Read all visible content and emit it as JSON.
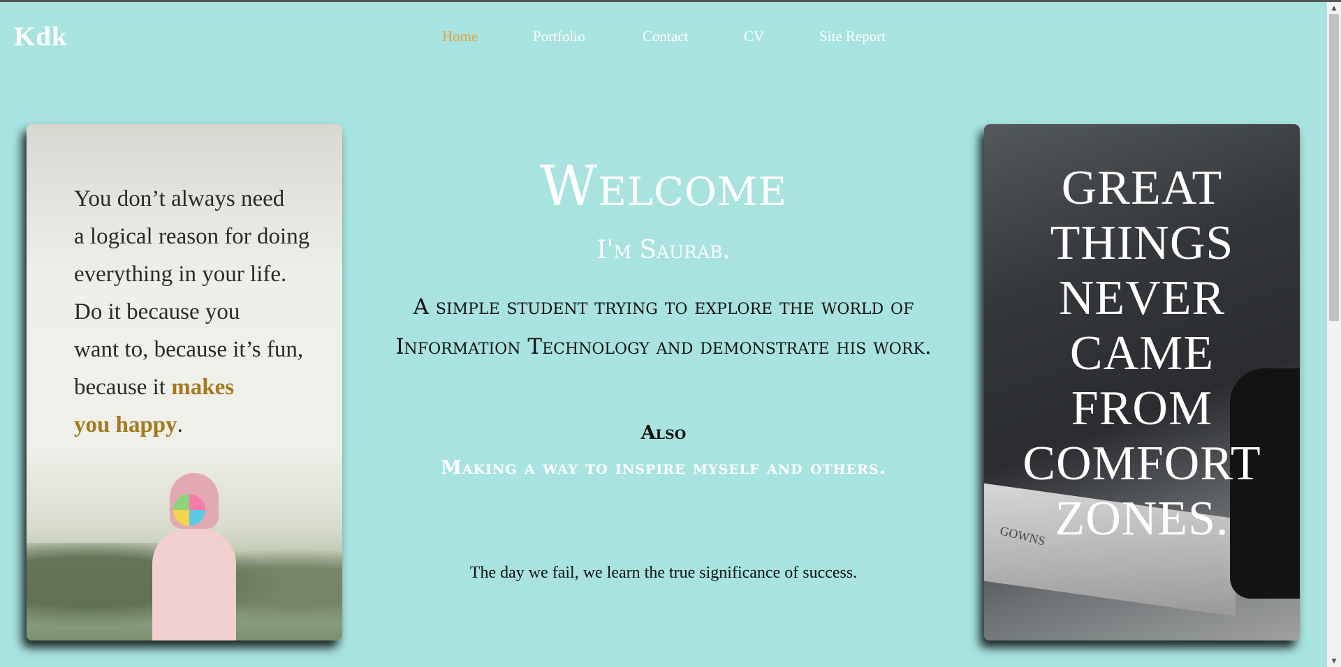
{
  "header": {
    "logo": "Kdk",
    "nav": [
      {
        "label": "Home",
        "active": true
      },
      {
        "label": "Portfolio",
        "active": false
      },
      {
        "label": "Contact",
        "active": false
      },
      {
        "label": "CV",
        "active": false
      },
      {
        "label": "Site Report",
        "active": false
      }
    ]
  },
  "hero": {
    "welcome": "Welcome",
    "intro": "I'm Saurab.",
    "tagline": "A simple student trying to explore the world of Information Technology and demonstrate his work.",
    "also": "Also",
    "inspire": "Making a way to inspire myself and others.",
    "motto": "The day we fail, we learn the true significance of success."
  },
  "left_poster": {
    "lines": [
      "You don’t always need",
      "a logical reason for doing",
      "everything in your life.",
      "Do it because you",
      "want to, because it’s fun,"
    ],
    "line6_plain": "because it ",
    "line6_highlight": "makes",
    "line7_highlight": "you happy",
    "line7_end": "."
  },
  "right_poster": {
    "lines": [
      "GREAT",
      "THINGS",
      "NEVER",
      "CAME",
      "FROM",
      "COMFORT",
      "ZONES."
    ],
    "book_text": "GOWNS"
  },
  "colors": {
    "background": "#a8e3e0",
    "nav_active": "#e3a33c",
    "nav_text": "#ffffff",
    "highlight": "#a5791f"
  },
  "icons": {
    "scroll_up": "▲",
    "scroll_down": "▼"
  }
}
